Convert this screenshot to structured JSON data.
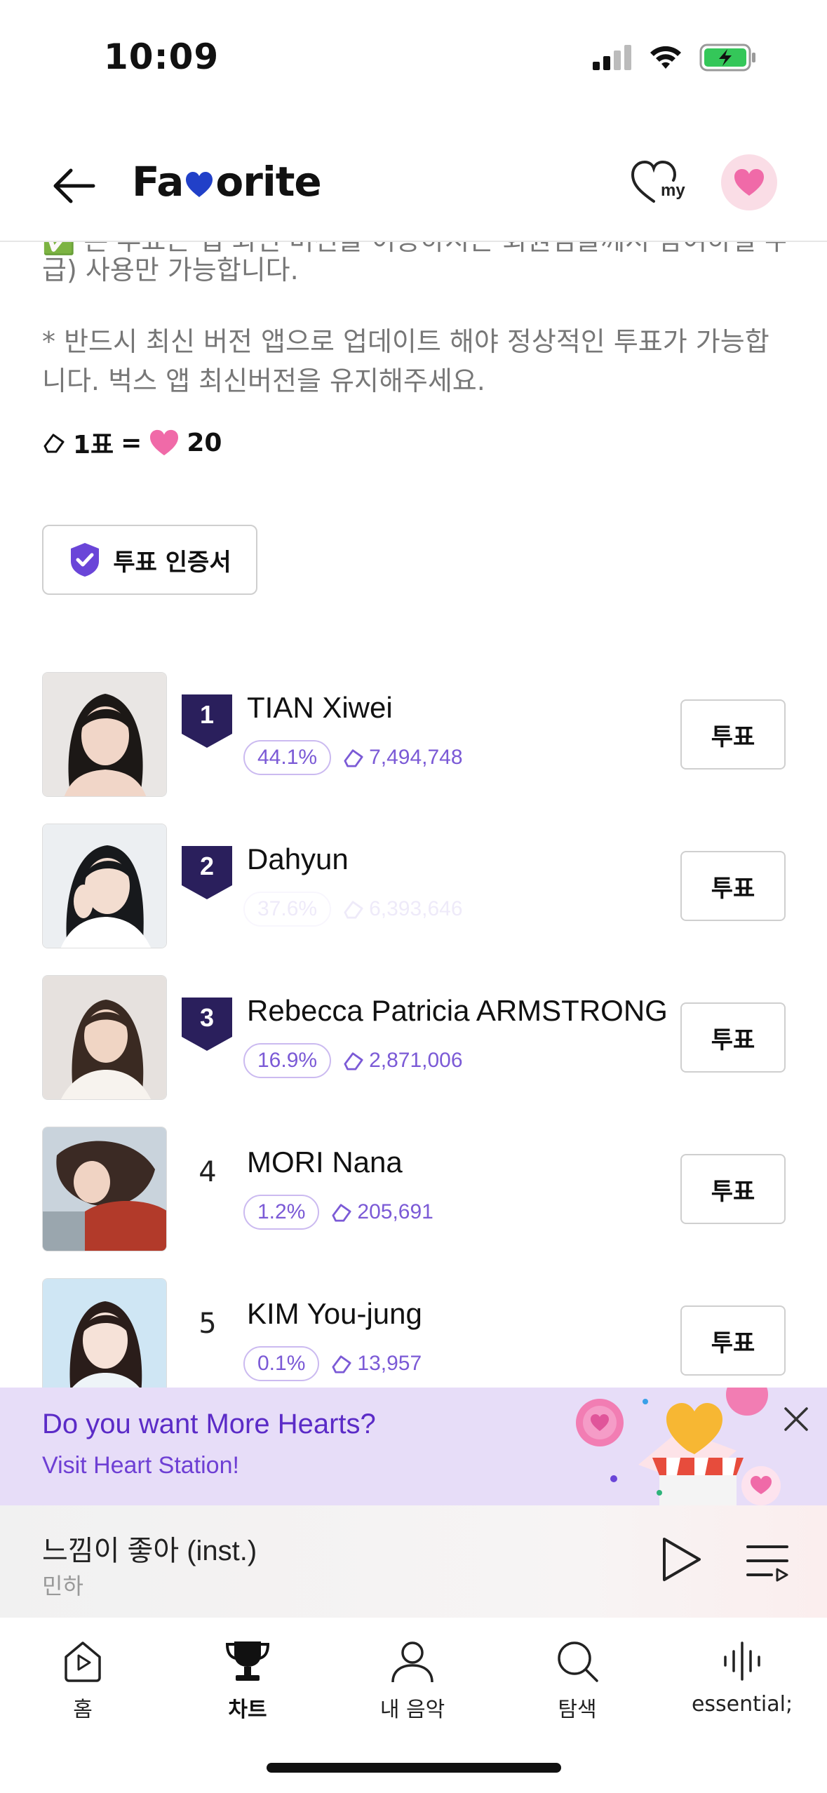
{
  "status": {
    "time": "10:09"
  },
  "header": {
    "title_pre": "Fa",
    "title_post": "orite",
    "my_label": "my"
  },
  "notice": {
    "line_cut_top": "✅ 본 투표는 앱 최신 버전을 이용하시는 회원님들께서 참여하실 수 있습니다(무료 이",
    "line_cut": "급) 사용만 가능합니다.",
    "line2": "* 반드시 최신 버전 앱으로 업데이트 해야 정상적인 투표가 가능합니다. 벅스 앱 최신버전을 유지해주세요.",
    "rate_vote": "1표",
    "rate_eq": "=",
    "rate_hearts": "20"
  },
  "cert_button": {
    "label": "투표 인증서"
  },
  "ranking": [
    {
      "rank": "1",
      "name": "TIAN Xiwei",
      "pct": "44.1%",
      "votes": "7,494,748",
      "vote_label": "투표",
      "faded": false,
      "badge": true
    },
    {
      "rank": "2",
      "name": "Dahyun",
      "pct": "37.6%",
      "votes": "6,393,646",
      "vote_label": "투표",
      "faded": true,
      "badge": true
    },
    {
      "rank": "3",
      "name": "Rebecca Patricia ARMSTRONG",
      "pct": "16.9%",
      "votes": "2,871,006",
      "vote_label": "투표",
      "faded": false,
      "badge": true
    },
    {
      "rank": "4",
      "name": "MORI Nana",
      "pct": "1.2%",
      "votes": "205,691",
      "vote_label": "투표",
      "faded": false,
      "badge": false
    },
    {
      "rank": "5",
      "name": "KIM You-jung",
      "pct": "0.1%",
      "votes": "13,957",
      "vote_label": "투표",
      "faded": false,
      "badge": false
    }
  ],
  "promo": {
    "title": "Do you want More Hearts?",
    "subtitle": "Visit Heart Station!"
  },
  "player": {
    "title": "느낌이 좋아 (inst.)",
    "artist": "민하"
  },
  "tabs": [
    {
      "label": "홈",
      "icon": "home-icon"
    },
    {
      "label": "차트",
      "icon": "trophy-icon"
    },
    {
      "label": "내 음악",
      "icon": "person-icon"
    },
    {
      "label": "탐색",
      "icon": "search-icon"
    },
    {
      "label": "essential;",
      "icon": "soundwave-icon"
    }
  ],
  "colors": {
    "accent_purple": "#7b5ad6",
    "badge_navy": "#2a1f5c",
    "promo_bg": "#e7ddf8",
    "heart_pink": "#f06aa8"
  }
}
